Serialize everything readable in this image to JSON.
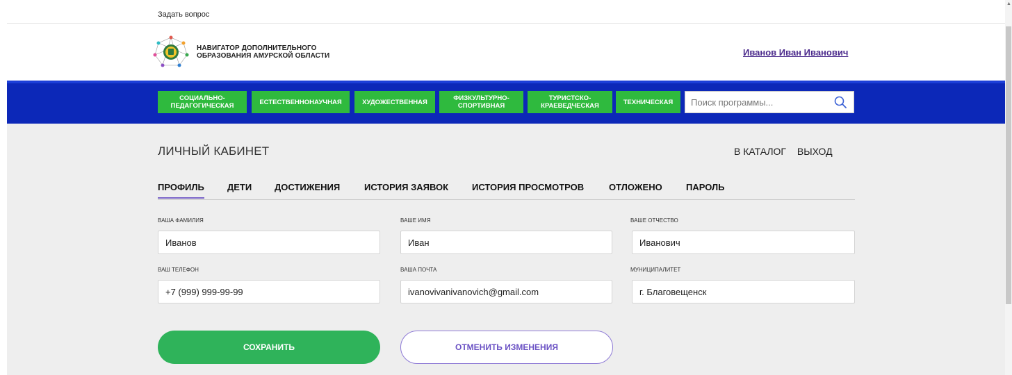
{
  "topbar": {
    "ask_question": "Задать вопрос"
  },
  "header": {
    "logo_line1": "НАВИГАТОР ДОПОЛНИТЕЛЬНОГО",
    "logo_line2": "ОБРАЗОВАНИЯ АМУРСКОЙ ОБЛАСТИ",
    "user_name": "Иванов Иван Иванович"
  },
  "nav": {
    "items": [
      {
        "line1": "СОЦИАЛЬНО-",
        "line2": "ПЕДАГОГИЧЕСКАЯ"
      },
      {
        "line1": "ЕСТЕСТВЕННОНАУЧНАЯ",
        "line2": ""
      },
      {
        "line1": "ХУДОЖЕСТВЕННАЯ",
        "line2": ""
      },
      {
        "line1": "ФИЗКУЛЬТУРНО-",
        "line2": "СПОРТИВНАЯ"
      },
      {
        "line1": "ТУРИСТСКО-",
        "line2": "КРАЕВЕДЧЕСКАЯ"
      },
      {
        "line1": "ТЕХНИЧЕСКАЯ",
        "line2": ""
      }
    ],
    "search_placeholder": "Поиск программы..."
  },
  "main": {
    "title": "ЛИЧНЫЙ КАБИНЕТ",
    "catalog_link": "В КАТАЛОГ",
    "logout_link": "ВЫХОД",
    "tabs": [
      "ПРОФИЛЬ",
      "ДЕТИ",
      "ДОСТИЖЕНИЯ",
      "ИСТОРИЯ ЗАЯВОК",
      "ИСТОРИЯ ПРОСМОТРОВ",
      "ОТЛОЖЕНО",
      "ПАРОЛЬ"
    ],
    "active_tab": "ПРОФИЛЬ",
    "fields": {
      "surname": {
        "label": "ВАША ФАМИЛИЯ",
        "value": "Иванов"
      },
      "name": {
        "label": "ВАШЕ ИМЯ",
        "value": "Иван"
      },
      "patronymic": {
        "label": "ВАШЕ ОТЧЕСТВО",
        "value": "Иванович"
      },
      "phone": {
        "label": "ВАШ ТЕЛЕФОН",
        "value": "+7 (999) 999-99-99"
      },
      "email": {
        "label": "ВАША ПОЧТА",
        "value": "ivanovivanivanovich@gmail.com"
      },
      "municipality": {
        "label": "МУНИЦИПАЛИТЕТ",
        "value": "г. Благовещенск"
      }
    },
    "save_label": "СОХРАНИТЬ",
    "cancel_label": "ОТМЕНИТЬ ИЗМЕНЕНИЯ"
  },
  "colors": {
    "nav_blue": "#0c28b8",
    "nav_green": "#2fba3e",
    "save_green": "#2fb35a",
    "accent_purple": "#6b52c4"
  }
}
